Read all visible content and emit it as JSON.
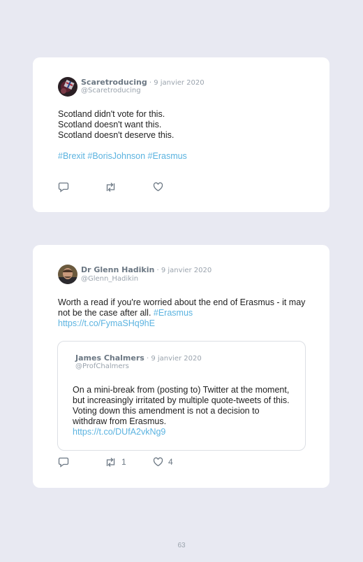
{
  "tweets": [
    {
      "author": "Scaretroducing",
      "date": " · 9 janvier 2020",
      "handle": "@Scaretroducing",
      "lines": "Scotland didn't vote for this.\nScotland doesn't want this.\nScotland doesn't deserve this.",
      "hashtags": "#Brexit #BorisJohnson #Erasmus",
      "retweets": "",
      "likes": ""
    },
    {
      "author": "Dr Glenn Hadikin",
      "date": " · 9 janvier 2020",
      "handle": "@Glenn_Hadikin",
      "text": "Worth a read if you're worried about the end of Erasmus - it may not be the case after all. ",
      "hashtag": "#Erasmus",
      "link": "https://t.co/FymaSHq9hE",
      "retweets": "1",
      "likes": "4",
      "quote": {
        "author": "James Chalmers",
        "date": " · 9 janvier 2020",
        "handle": "@ProfChalmers",
        "text": "On a mini-break from (posting to) Twitter at the moment, but increasingly irritated by multiple quote-tweets of this. Voting down this amendment is not a decision to withdraw from Erasmus.",
        "link": "https://t.co/DUfA2vkNg9"
      }
    }
  ],
  "page_number": "63",
  "icons": [
    "reply-icon",
    "retweet-icon",
    "like-icon"
  ],
  "colors": {
    "background": "#e8e9f2",
    "link": "#5bb3e0",
    "muted": "#9aa3ad"
  }
}
